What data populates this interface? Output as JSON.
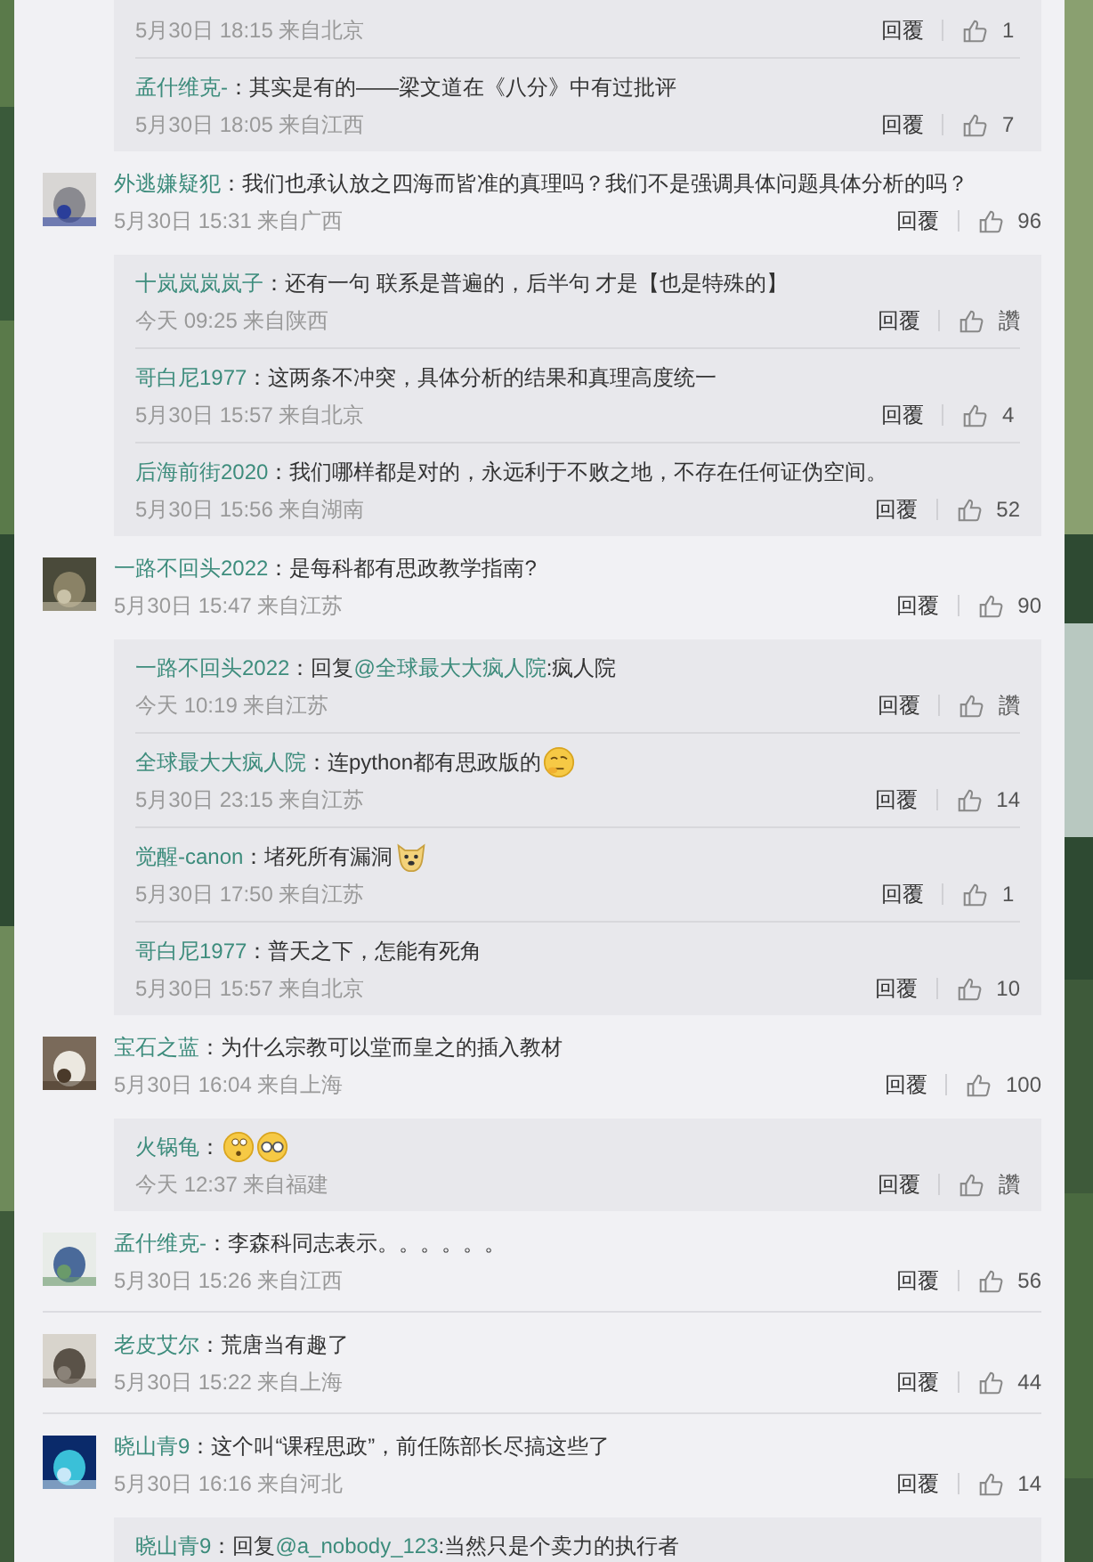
{
  "leading_replies": [
    {
      "meta": "5月30日 18:15 来自北京",
      "reply_label": "回覆",
      "likes": "1"
    },
    {
      "name": "孟什维克-",
      "text": "：其实是有的——梁文道在《八分》中有过批评",
      "meta": "5月30日 18:05 来自江西",
      "reply_label": "回覆",
      "likes": "7"
    }
  ],
  "comments": [
    {
      "name": "外逃嫌疑犯",
      "text": "：我们也承认放之四海而皆准的真理吗？我们不是强调具体问题具体分析的吗？",
      "meta": "5月30日 15:31 来自广西",
      "reply_label": "回覆",
      "likes": "96",
      "replies": [
        {
          "name": "十岚岚岚岚子",
          "text": "：还有一句 联系是普遍的，后半句 才是【也是特殊的】",
          "meta": "今天 09:25 来自陕西",
          "reply_label": "回覆",
          "likes": "讚"
        },
        {
          "name": "哥白尼1977",
          "text": "：这两条不冲突，具体分析的结果和真理高度统一",
          "meta": "5月30日 15:57 来自北京",
          "reply_label": "回覆",
          "likes": "4"
        },
        {
          "name": "后海前街2020",
          "text": "：我们哪样都是对的，永远利于不败之地，不存在任何证伪空间。",
          "meta": "5月30日 15:56 来自湖南",
          "reply_label": "回覆",
          "likes": "52"
        }
      ]
    },
    {
      "name": "一路不回头2022",
      "text": "：是每科都有思政教学指南?",
      "meta": "5月30日 15:47 来自江苏",
      "reply_label": "回覆",
      "likes": "90",
      "replies": [
        {
          "name": "一路不回头2022",
          "text": "：回复",
          "mention": "@全球最大大疯人院",
          "text_after": ":疯人院",
          "meta": "今天 10:19 来自江苏",
          "reply_label": "回覆",
          "likes": "讚"
        },
        {
          "name": "全球最大大疯人院",
          "text": "：连python都有思政版的",
          "emojis": [
            {
              "kind": "thinking"
            }
          ],
          "meta": "5月30日 23:15 来自江苏",
          "reply_label": "回覆",
          "likes": "14"
        },
        {
          "name": "觉醒-canon",
          "text": "：堵死所有漏洞",
          "emojis": [
            {
              "kind": "doge"
            }
          ],
          "meta": "5月30日 17:50 来自江苏",
          "reply_label": "回覆",
          "likes": "1"
        },
        {
          "name": "哥白尼1977",
          "text": "：普天之下，怎能有死角",
          "meta": "5月30日 15:57 来自北京",
          "reply_label": "回覆",
          "likes": "10"
        }
      ]
    },
    {
      "name": "宝石之蓝",
      "text": "：为什么宗教可以堂而皇之的插入教材",
      "meta": "5月30日 16:04 来自上海",
      "reply_label": "回覆",
      "likes": "100",
      "replies": [
        {
          "name": "火锅龟",
          "text": "：",
          "emojis": [
            {
              "kind": "wondering"
            },
            {
              "kind": "glasses"
            }
          ],
          "meta": "今天 12:37 来自福建",
          "reply_label": "回覆",
          "likes": "讚"
        }
      ]
    },
    {
      "name": "孟什维克-",
      "text": "：李森科同志表示。。。。。。",
      "meta": "5月30日 15:26 来自江西",
      "reply_label": "回覆",
      "likes": "56"
    },
    {
      "name": "老皮艾尔",
      "text": "：荒唐当有趣了",
      "meta": "5月30日 15:22 来自上海",
      "reply_label": "回覆",
      "likes": "44"
    },
    {
      "name": "晓山青9",
      "text": "：这个叫“课程思政”，前任陈部长尽搞这些了",
      "meta": "5月30日 16:16 来自河北",
      "reply_label": "回覆",
      "likes": "14",
      "replies": [
        {
          "name": "晓山青9",
          "text": "：回复 ",
          "mention": "@a_nobody_123",
          "text_after": ":当然只是个卖力的执行者"
        }
      ]
    }
  ]
}
